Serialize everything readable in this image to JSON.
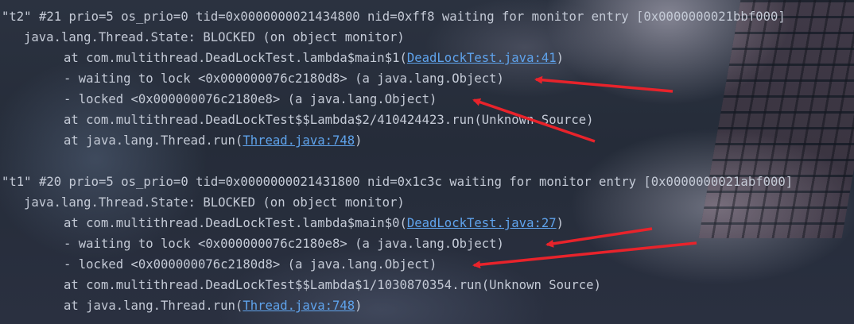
{
  "thread_dump": [
    {
      "header": "\"t2\" #21 prio=5 os_prio=0 tid=0x0000000021434800 nid=0xff8 waiting for monitor entry [0x0000000021bbf000]",
      "state": "java.lang.Thread.State: BLOCKED (on object monitor)",
      "frame1_prefix": "at com.multithread.DeadLockTest.lambda$main$1(",
      "frame1_link": "DeadLockTest.java:41",
      "frame1_suffix": ")",
      "waiting": "- waiting to lock <0x000000076c2180d8> (a java.lang.Object)",
      "locked": "- locked <0x000000076c2180e8> (a java.lang.Object)",
      "frame2": "at com.multithread.DeadLockTest$$Lambda$2/410424423.run(Unknown Source)",
      "frame3_prefix": "at java.lang.Thread.run(",
      "frame3_link": "Thread.java:748",
      "frame3_suffix": ")"
    },
    {
      "header": "\"t1\" #20 prio=5 os_prio=0 tid=0x0000000021431800 nid=0x1c3c waiting for monitor entry [0x0000000021abf000]",
      "state": "java.lang.Thread.State: BLOCKED (on object monitor)",
      "frame1_prefix": "at com.multithread.DeadLockTest.lambda$main$0(",
      "frame1_link": "DeadLockTest.java:27",
      "frame1_suffix": ")",
      "waiting": "- waiting to lock <0x000000076c2180e8> (a java.lang.Object)",
      "locked": "- locked <0x000000076c2180d8> (a java.lang.Object)",
      "frame2": "at com.multithread.DeadLockTest$$Lambda$1/1030870354.run(Unknown Source)",
      "frame3_prefix": "at java.lang.Thread.run(",
      "frame3_link": "Thread.java:748",
      "frame3_suffix": ")"
    }
  ],
  "colors": {
    "text": "#c4cad6",
    "link": "#5fa3ec",
    "annotation_arrow": "#e8232b"
  }
}
